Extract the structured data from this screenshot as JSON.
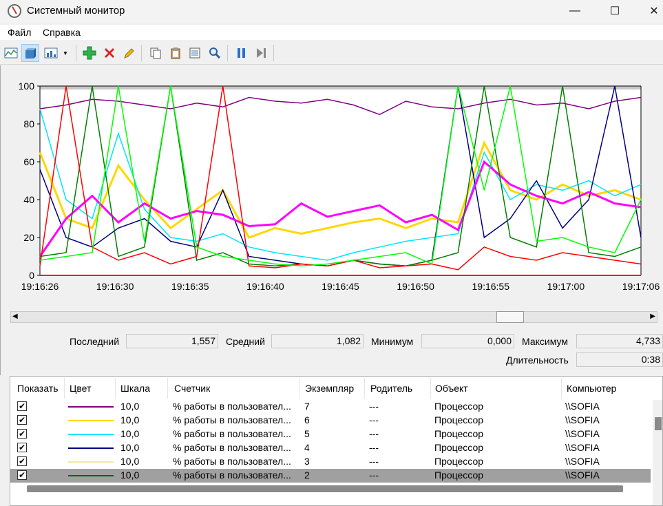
{
  "window": {
    "title": "Системный монитор",
    "minimize": "—",
    "maximize": "☐",
    "close": "✕"
  },
  "menu": [
    "Файл",
    "Справка"
  ],
  "toolbar": {
    "icons": [
      "view-graph-icon",
      "view-histogram-icon",
      "view-report-icon",
      "dropdown-icon",
      "add-counter-icon",
      "delete-counter-icon",
      "highlight-icon",
      "copy-properties-icon",
      "paste-counter-list-icon",
      "properties-icon",
      "zoom-icon",
      "freeze-display-icon",
      "update-data-icon"
    ]
  },
  "chart_data": {
    "type": "line",
    "title": "",
    "xlabel": "",
    "ylabel": "",
    "ylim": [
      0,
      100
    ],
    "yticks": [
      0,
      20,
      40,
      60,
      80,
      100
    ],
    "xticks": [
      "19:16:26",
      "19:16:30",
      "19:16:35",
      "19:16:40",
      "19:16:45",
      "19:16:50",
      "19:16:55",
      "19:17:00",
      "19:17:06"
    ],
    "series": [
      {
        "color": "#800080",
        "values": [
          88,
          90,
          93,
          92,
          90,
          88,
          91,
          89,
          94,
          92,
          91,
          93,
          90,
          85,
          92,
          89,
          88,
          91,
          93,
          90,
          91,
          88,
          92,
          94
        ]
      },
      {
        "color": "#ffd700",
        "values": [
          65,
          30,
          25,
          58,
          40,
          25,
          35,
          45,
          20,
          25,
          22,
          25,
          28,
          30,
          25,
          30,
          28,
          70,
          45,
          40,
          48,
          42,
          45,
          40
        ]
      },
      {
        "color": "#00e5ff",
        "values": [
          88,
          40,
          30,
          75,
          35,
          20,
          18,
          22,
          15,
          12,
          10,
          8,
          12,
          15,
          18,
          20,
          22,
          65,
          40,
          48,
          45,
          50,
          42,
          48
        ]
      },
      {
        "color": "#000080",
        "values": [
          56,
          20,
          15,
          25,
          30,
          18,
          15,
          45,
          10,
          8,
          6,
          5,
          8,
          6,
          5,
          8,
          100,
          20,
          30,
          50,
          25,
          40,
          100,
          20
        ]
      },
      {
        "color": "#ff00ff",
        "values": [
          10,
          30,
          42,
          28,
          38,
          30,
          34,
          32,
          26,
          27,
          38,
          31,
          34,
          37,
          28,
          32,
          24,
          60,
          48,
          42,
          38,
          44,
          38,
          36
        ]
      },
      {
        "color": "#008000",
        "values": [
          10,
          12,
          100,
          10,
          15,
          100,
          8,
          12,
          6,
          5,
          6,
          5,
          8,
          6,
          5,
          8,
          12,
          100,
          20,
          15,
          100,
          12,
          10,
          15
        ]
      },
      {
        "color": "#ff0000",
        "values": [
          5,
          100,
          15,
          8,
          12,
          6,
          10,
          100,
          5,
          4,
          6,
          5,
          8,
          4,
          5,
          6,
          3,
          15,
          10,
          8,
          12,
          10,
          8,
          6
        ]
      },
      {
        "color": "#00ff00",
        "values": [
          8,
          10,
          12,
          100,
          18,
          100,
          15,
          10,
          8,
          6,
          5,
          6,
          8,
          10,
          12,
          6,
          100,
          45,
          100,
          18,
          20,
          15,
          12,
          40
        ]
      }
    ]
  },
  "stats": {
    "last_label": "Последний",
    "last_value": "1,557",
    "avg_label": "Средний",
    "avg_value": "1,082",
    "min_label": "Минимум",
    "min_value": "0,000",
    "max_label": "Максимум",
    "max_value": "4,733",
    "duration_label": "Длительность",
    "duration_value": "0:38"
  },
  "table": {
    "headers": [
      "Показать",
      "Цвет",
      "Шкала",
      "Счетчик",
      "Экземпляр",
      "Родитель",
      "Объект",
      "Компьютер"
    ],
    "rows": [
      {
        "color": "#800080",
        "scale": "10,0",
        "counter": "% работы в пользовател...",
        "instance": "7",
        "parent": "---",
        "object": "Процессор",
        "computer": "\\\\SOFIA"
      },
      {
        "color": "#ffd700",
        "scale": "10,0",
        "counter": "% работы в пользовател...",
        "instance": "6",
        "parent": "---",
        "object": "Процессор",
        "computer": "\\\\SOFIA"
      },
      {
        "color": "#00e5ff",
        "scale": "10,0",
        "counter": "% работы в пользовател...",
        "instance": "5",
        "parent": "---",
        "object": "Процессор",
        "computer": "\\\\SOFIA"
      },
      {
        "color": "#000080",
        "scale": "10,0",
        "counter": "% работы в пользовател...",
        "instance": "4",
        "parent": "---",
        "object": "Процессор",
        "computer": "\\\\SOFIA"
      },
      {
        "color": "#f5e6a0",
        "scale": "10,0",
        "counter": "% работы в пользовател...",
        "instance": "3",
        "parent": "---",
        "object": "Процессор",
        "computer": "\\\\SOFIA"
      },
      {
        "color": "#006400",
        "scale": "10,0",
        "counter": "% работы в пользовател...",
        "instance": "2",
        "parent": "---",
        "object": "Процессор",
        "computer": "\\\\SOFIA"
      }
    ]
  }
}
